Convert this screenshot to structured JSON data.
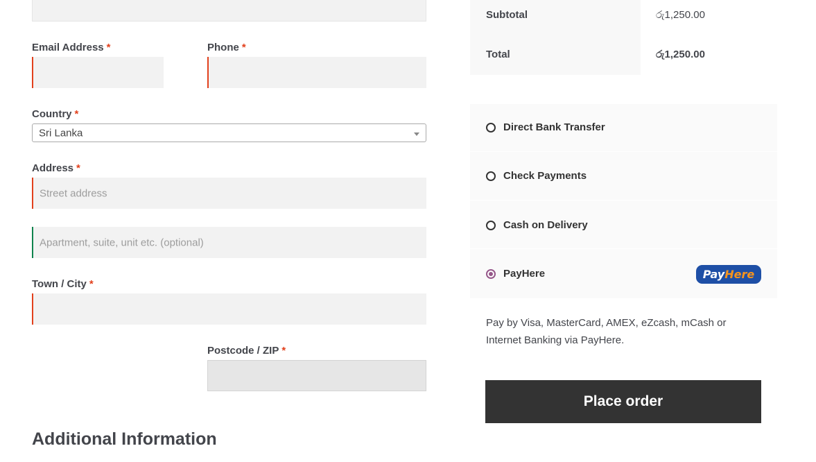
{
  "form": {
    "email_label": "Email Address",
    "phone_label": "Phone",
    "country_label": "Country",
    "country_value": "Sri Lanka",
    "address_label": "Address",
    "street_placeholder": "Street address",
    "apartment_placeholder": "Apartment, suite, unit etc. (optional)",
    "city_label": "Town / City",
    "postcode_label": "Postcode / ZIP",
    "required_mark": "*",
    "additional_heading": "Additional Information"
  },
  "totals": {
    "subtotal_label": "Subtotal",
    "subtotal_value": "රු1,250.00",
    "total_label": "Total",
    "total_value": "රු1,250.00"
  },
  "payment": {
    "methods": [
      {
        "label": "Direct Bank Transfer",
        "selected": false
      },
      {
        "label": "Check Payments",
        "selected": false
      },
      {
        "label": "Cash on Delivery",
        "selected": false
      },
      {
        "label": "PayHere",
        "selected": true
      }
    ],
    "logo_text_pay": "Pay",
    "logo_text_here": "Here",
    "description": "Pay by Visa, MasterCard, AMEX, eZcash, mCash or Internet Banking via PayHere."
  },
  "place_order_label": "Place order",
  "colors": {
    "required": "#e2401c",
    "valid": "#0f834d",
    "radio_selected": "#96588a",
    "button_bg": "#333333"
  }
}
